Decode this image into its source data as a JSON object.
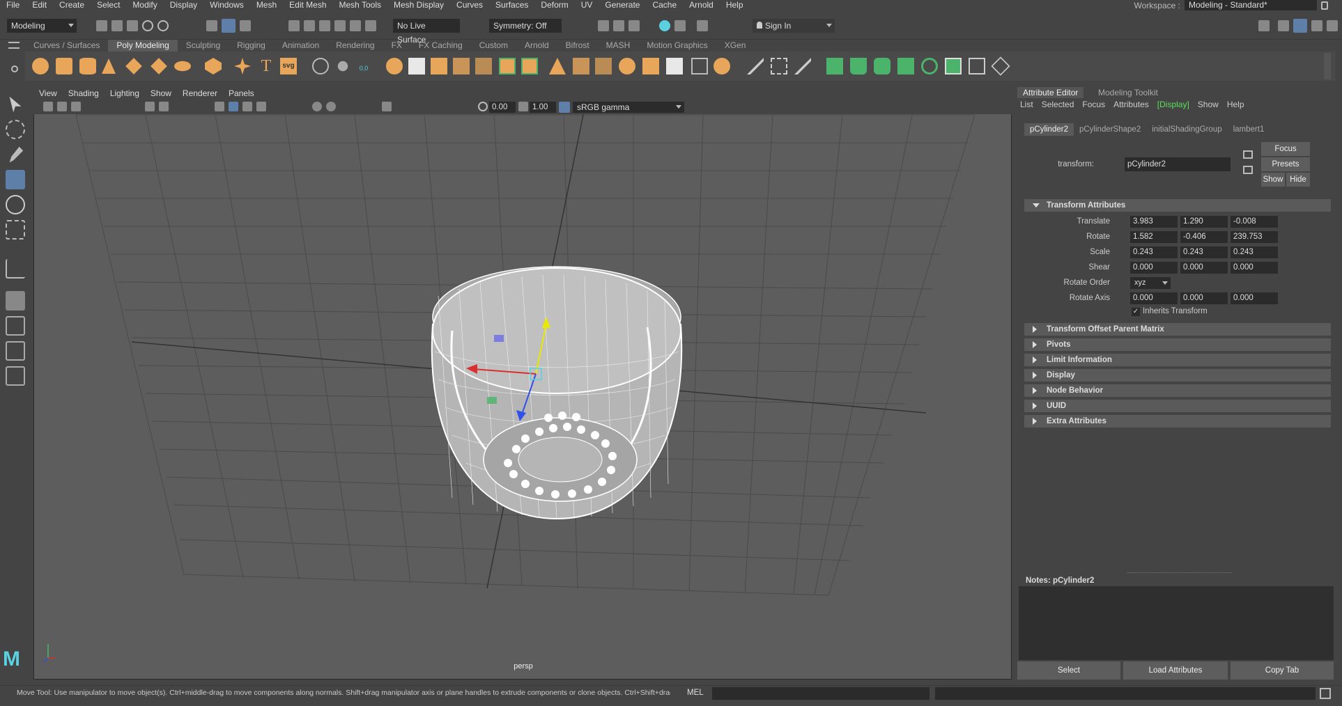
{
  "menubar": [
    "File",
    "Edit",
    "Create",
    "Select",
    "Modify",
    "Display",
    "Windows",
    "Mesh",
    "Edit Mesh",
    "Mesh Tools",
    "Mesh Display",
    "Curves",
    "Surfaces",
    "Deform",
    "UV",
    "Generate",
    "Cache",
    "Arnold",
    "Help"
  ],
  "workspace": {
    "label": "Workspace :",
    "value": "Modeling - Standard*"
  },
  "statusline": {
    "menuset": "Modeling",
    "live_surface": "No Live Surface",
    "symmetry": "Symmetry: Off",
    "sign_in": "Sign In"
  },
  "shelf_tabs": [
    "Curves / Surfaces",
    "Poly Modeling",
    "Sculpting",
    "Rigging",
    "Animation",
    "Rendering",
    "FX",
    "FX Caching",
    "Custom",
    "Arnold",
    "Bifrost",
    "MASH",
    "Motion Graphics",
    "XGen"
  ],
  "shelf_active": "Poly Modeling",
  "shelf_icons": {
    "text_icon": "T",
    "svg_icon": "svg",
    "coord_icon": "0,0"
  },
  "viewport": {
    "menu": [
      "View",
      "Shading",
      "Lighting",
      "Show",
      "Renderer",
      "Panels"
    ],
    "exposure": "0.00",
    "gamma": "1.00",
    "color_space": "sRGB gamma",
    "camera_label": "persp"
  },
  "ae": {
    "tabs": [
      "Attribute Editor",
      "Modeling Toolkit"
    ],
    "menu": [
      "List",
      "Selected",
      "Focus",
      "Attributes",
      "[Display]",
      "Show",
      "Help"
    ],
    "node_tabs": [
      "pCylinder2",
      "pCylinderShape2",
      "initialShadingGroup",
      "lambert1"
    ],
    "transform_label": "transform:",
    "transform_value": "pCylinder2",
    "buttons": {
      "focus": "Focus",
      "presets": "Presets",
      "show": "Show",
      "hide": "Hide"
    },
    "transform_section": "Transform Attributes",
    "rows": [
      {
        "label": "Translate",
        "values": [
          "3.983",
          "1.290",
          "-0.008"
        ]
      },
      {
        "label": "Rotate",
        "values": [
          "1.582",
          "-0.406",
          "239.753"
        ]
      },
      {
        "label": "Scale",
        "values": [
          "0.243",
          "0.243",
          "0.243"
        ]
      },
      {
        "label": "Shear",
        "values": [
          "0.000",
          "0.000",
          "0.000"
        ]
      }
    ],
    "rotate_order_label": "Rotate Order",
    "rotate_order_value": "xyz",
    "rotate_axis": {
      "label": "Rotate Axis",
      "values": [
        "0.000",
        "0.000",
        "0.000"
      ]
    },
    "inherits": "Inherits Transform",
    "collapsed_sections": [
      "Transform Offset Parent Matrix",
      "Pivots",
      "Limit Information",
      "Display",
      "Node Behavior",
      "UUID",
      "Extra Attributes"
    ],
    "notes_label": "Notes:  pCylinder2",
    "bottom_buttons": [
      "Select",
      "Load Attributes",
      "Copy Tab"
    ]
  },
  "helpline": {
    "text": "Move Tool: Use manipulator to move object(s). Ctrl+middle-drag to move components along normals. Shift+drag manipulator axis or plane handles to extrude components or clone objects. Ctrl+Shift+drag to con",
    "mel": "MEL"
  },
  "colors": {
    "accent_orange": "#e8a65a",
    "accent_green": "#4cb46a",
    "display_green": "#5be05b",
    "sel_blue": "#4f8fc8"
  }
}
